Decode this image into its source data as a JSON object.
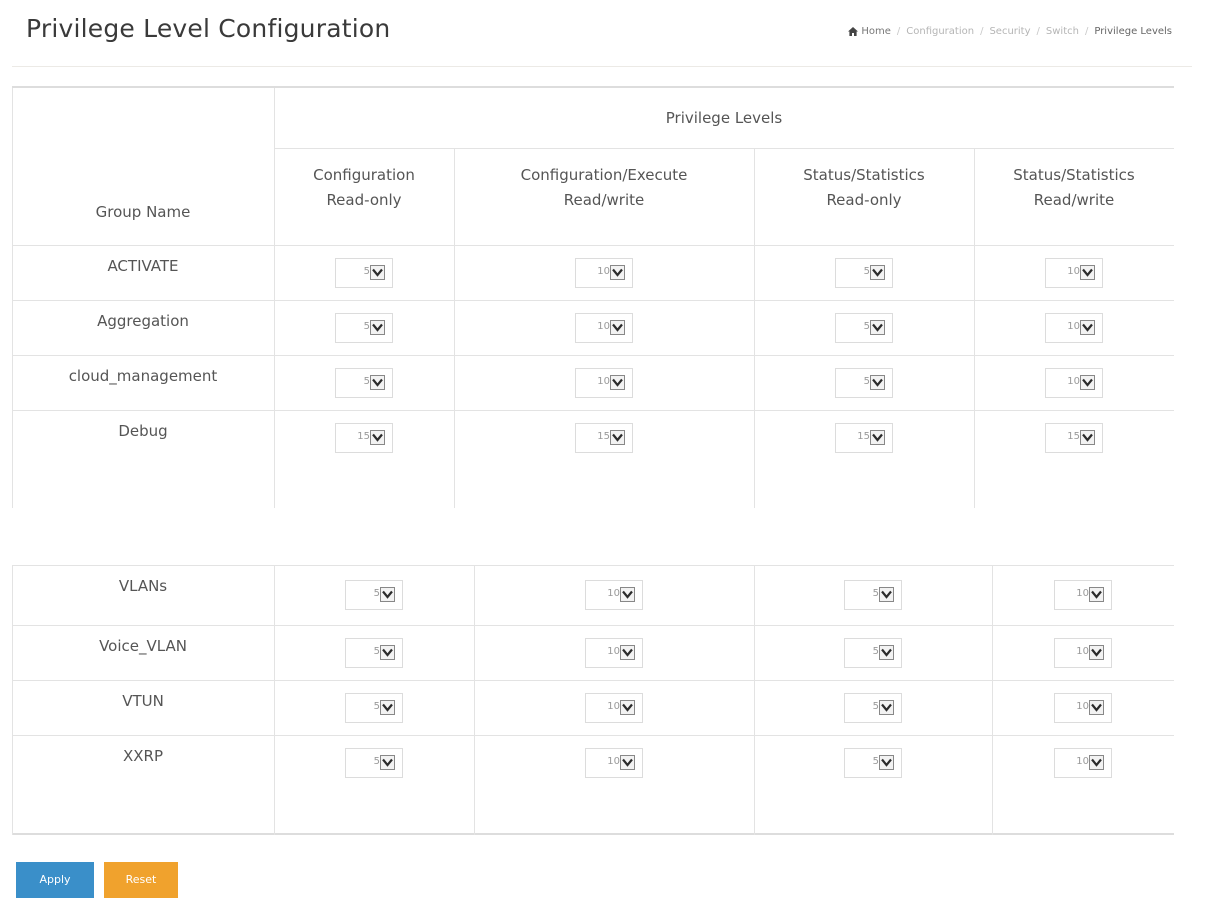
{
  "page": {
    "title": "Privilege Level Configuration"
  },
  "breadcrumb": [
    "Home",
    "Configuration",
    "Security",
    "Switch",
    "Privilege Levels"
  ],
  "table": {
    "group_header": "Group Name",
    "privilege_header": "Privilege Levels",
    "columns": [
      {
        "line1": "Configuration",
        "line2": "Read-only"
      },
      {
        "line1": "Configuration/Execute",
        "line2": "Read/write"
      },
      {
        "line1": "Status/Statistics",
        "line2": "Read-only"
      },
      {
        "line1": "Status/Statistics",
        "line2": "Read/write"
      }
    ],
    "rows": [
      {
        "name": "ACTIVATE",
        "levels": [
          "5",
          "10",
          "5",
          "10"
        ]
      },
      {
        "name": "Aggregation",
        "levels": [
          "5",
          "10",
          "5",
          "10"
        ]
      },
      {
        "name": "cloud_management",
        "levels": [
          "5",
          "10",
          "5",
          "10"
        ]
      },
      {
        "name": "Debug",
        "levels": [
          "15",
          "15",
          "15",
          "15"
        ]
      },
      {
        "name": "VLANs",
        "levels": [
          "5",
          "10",
          "5",
          "10"
        ]
      },
      {
        "name": "Voice_VLAN",
        "levels": [
          "5",
          "10",
          "5",
          "10"
        ]
      },
      {
        "name": "VTUN",
        "levels": [
          "5",
          "10",
          "5",
          "10"
        ]
      },
      {
        "name": "XXRP",
        "levels": [
          "5",
          "10",
          "5",
          "10"
        ]
      }
    ]
  },
  "buttons": {
    "apply": "Apply",
    "reset": "Reset"
  },
  "colors": {
    "apply": "#3a8fc9",
    "reset": "#f0a22d"
  },
  "icons": {
    "home": "home-icon",
    "dropdown": "chevron-down-icon"
  }
}
